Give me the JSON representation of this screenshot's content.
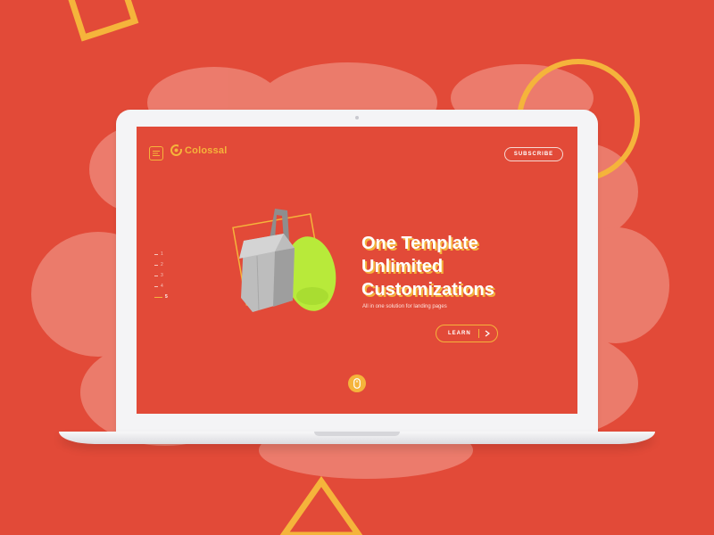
{
  "colors": {
    "background": "#e24a38",
    "accent": "#f5b43b",
    "laptop": "#f4f4f6",
    "text": "#ffffff"
  },
  "header": {
    "menu_icon": "hamburger-icon",
    "logo_icon": "colossal-logo-icon",
    "logo_text": "Colossal",
    "subscribe_label": "SUBSCRIBE"
  },
  "pager": {
    "items": [
      "1",
      "2",
      "3",
      "4",
      "5"
    ],
    "active_index": 4
  },
  "hero": {
    "title_lines": [
      "One Template",
      "Unlimited",
      "Customizations"
    ],
    "subtitle": "All in one solution for landing pages",
    "learn_label": "LEARN",
    "learn_icon": "chevron-right-icon",
    "scroll_icon": "mouse-scroll-icon"
  }
}
